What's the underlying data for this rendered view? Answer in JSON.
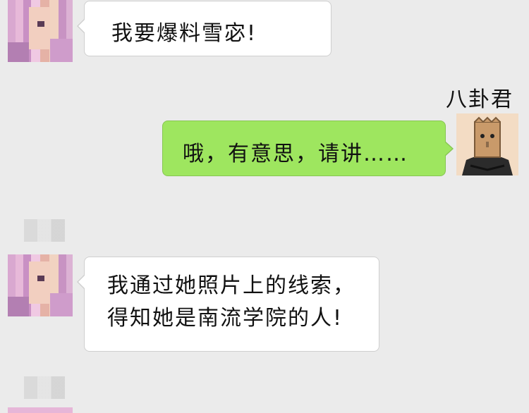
{
  "messages": [
    {
      "side": "left",
      "text_lines": [
        "我要爆料雪宓!"
      ]
    },
    {
      "side": "right",
      "sender": "八卦君",
      "text_lines": [
        "哦，有意思，请讲……"
      ]
    },
    {
      "side": "left",
      "text_lines": [
        "我通过她照片上的线索，",
        "得知她是南流学院的人!"
      ]
    }
  ],
  "colors": {
    "background": "#ebebeb",
    "incoming_bubble": "#ffffff",
    "outgoing_bubble": "#9ee65f"
  },
  "icons": {
    "incoming_avatar": "pixelated-pink-hair-avatar",
    "outgoing_avatar": "paper-bag-head-avatar"
  }
}
